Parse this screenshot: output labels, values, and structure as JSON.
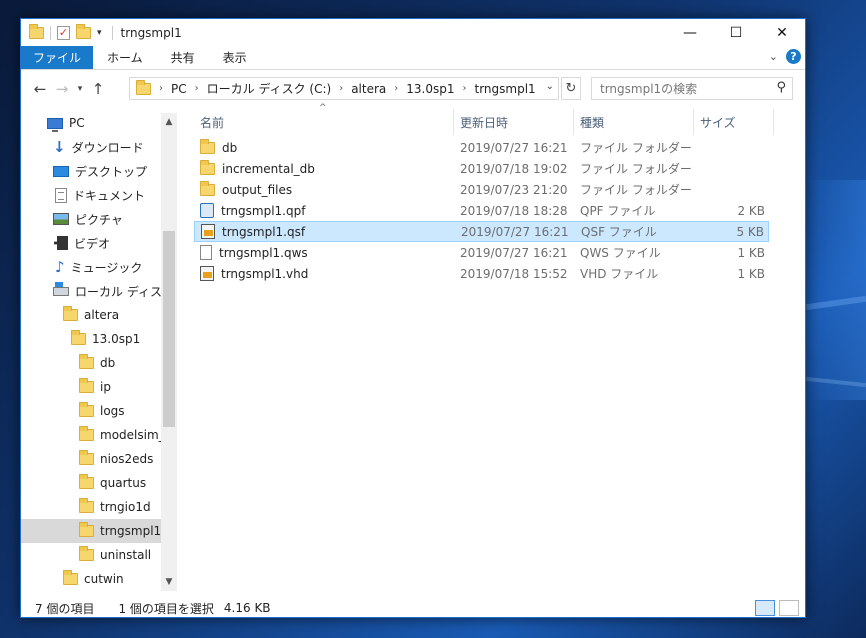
{
  "window": {
    "title": "trngsmpl1",
    "controls": {
      "minimize": "—",
      "maximize": "☐",
      "close": "✕"
    }
  },
  "ribbon": {
    "tabs": [
      {
        "label": "ファイル",
        "active": true
      },
      {
        "label": "ホーム"
      },
      {
        "label": "共有"
      },
      {
        "label": "表示"
      }
    ],
    "collapse": "⌄",
    "help": "?"
  },
  "address": {
    "crumbs": [
      "PC",
      "ローカル ディスク (C:)",
      "altera",
      "13.0sp1",
      "trngsmpl1"
    ],
    "search_placeholder": "trngsmpl1の検索"
  },
  "nav": {
    "items": [
      {
        "label": "PC",
        "icon": "pc-icon"
      },
      {
        "label": "ダウンロード",
        "icon": "download-icon"
      },
      {
        "label": "デスクトップ",
        "icon": "desktop-icon"
      },
      {
        "label": "ドキュメント",
        "icon": "document-icon"
      },
      {
        "label": "ピクチャ",
        "icon": "picture-icon"
      },
      {
        "label": "ビデオ",
        "icon": "video-icon"
      },
      {
        "label": "ミュージック",
        "icon": "music-icon"
      },
      {
        "label": "ローカル ディスク (C",
        "icon": "drive-icon"
      },
      {
        "label": "altera",
        "icon": "folder-icon"
      },
      {
        "label": "13.0sp1",
        "icon": "folder-icon"
      },
      {
        "label": "db",
        "icon": "folder-icon"
      },
      {
        "label": "ip",
        "icon": "folder-icon"
      },
      {
        "label": "logs",
        "icon": "folder-icon"
      },
      {
        "label": "modelsim_a",
        "icon": "folder-icon"
      },
      {
        "label": "nios2eds",
        "icon": "folder-icon"
      },
      {
        "label": "quartus",
        "icon": "folder-icon"
      },
      {
        "label": "trngio1d",
        "icon": "folder-icon"
      },
      {
        "label": "trngsmpl1",
        "icon": "folder-icon",
        "selected": true
      },
      {
        "label": "uninstall",
        "icon": "folder-icon"
      },
      {
        "label": "cutwin",
        "icon": "folder-icon"
      }
    ]
  },
  "columns": {
    "name": "名前",
    "date": "更新日時",
    "type": "種類",
    "size": "サイズ"
  },
  "files": [
    {
      "name": "db",
      "date": "2019/07/27 16:21",
      "type": "ファイル フォルダー",
      "size": "",
      "icon": "folder-icon"
    },
    {
      "name": "incremental_db",
      "date": "2019/07/18 19:02",
      "type": "ファイル フォルダー",
      "size": "",
      "icon": "folder-icon"
    },
    {
      "name": "output_files",
      "date": "2019/07/23 21:20",
      "type": "ファイル フォルダー",
      "size": "",
      "icon": "folder-icon"
    },
    {
      "name": "trngsmpl1.qpf",
      "date": "2019/07/18 18:28",
      "type": "QPF ファイル",
      "size": "2 KB",
      "icon": "qpf-file-icon"
    },
    {
      "name": "trngsmpl1.qsf",
      "date": "2019/07/27 16:21",
      "type": "QSF ファイル",
      "size": "5 KB",
      "icon": "qsf-file-icon",
      "selected": true
    },
    {
      "name": "trngsmpl1.qws",
      "date": "2019/07/27 16:21",
      "type": "QWS ファイル",
      "size": "1 KB",
      "icon": "file-icon"
    },
    {
      "name": "trngsmpl1.vhd",
      "date": "2019/07/18 15:52",
      "type": "VHD ファイル",
      "size": "1 KB",
      "icon": "vhd-file-icon"
    }
  ],
  "status": {
    "item_count": "7 個の項目",
    "selection": "1 個の項目を選択",
    "selection_size": "4.16 KB"
  }
}
